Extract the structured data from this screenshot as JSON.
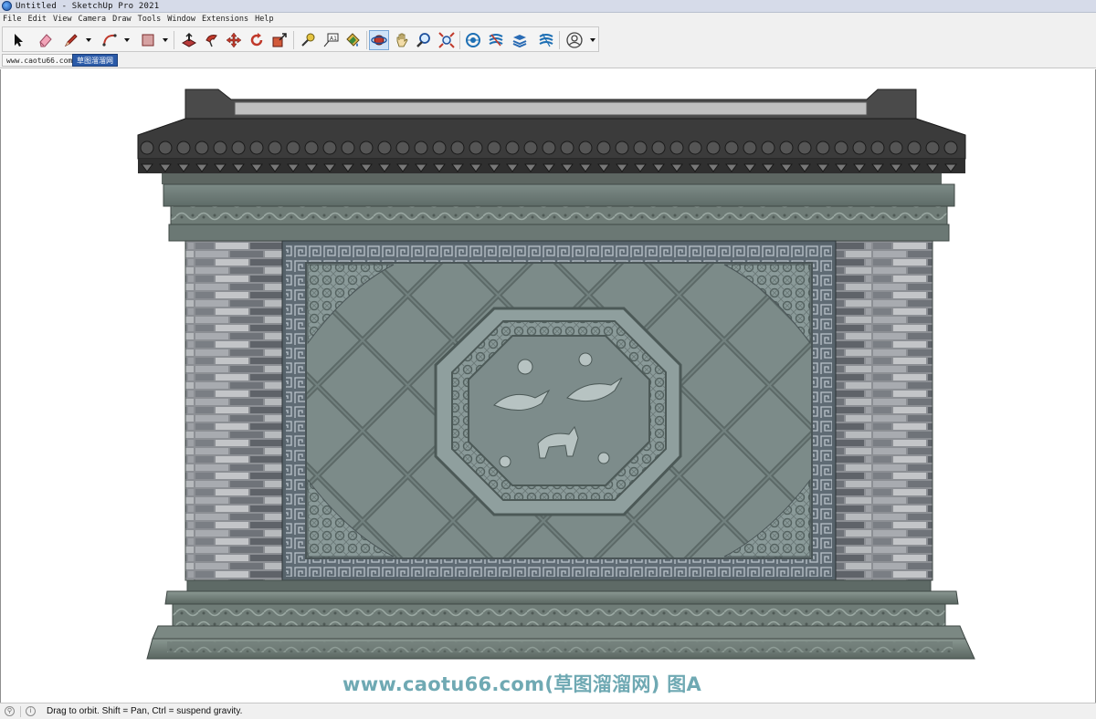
{
  "window": {
    "title": "Untitled - SketchUp Pro 2021"
  },
  "menu": [
    "File",
    "Edit",
    "View",
    "Camera",
    "Draw",
    "Tools",
    "Window",
    "Extensions",
    "Help"
  ],
  "toolbar": {
    "tools": [
      "select-tool",
      "eraser-tool",
      "line-tool",
      "arc-tool",
      "rectangle-tool",
      "push-pull-tool",
      "follow-me-tool",
      "move-tool",
      "rotate-tool",
      "scale-tool",
      "tape-measure-tool",
      "text-tool",
      "paint-bucket-tool",
      "orbit-tool",
      "pan-tool",
      "zoom-tool",
      "zoom-extents-tool",
      "warehouse-tool",
      "extension-warehouse-tool",
      "layout-tool",
      "extension-manager-tool",
      "account-tool"
    ],
    "active_tool": "orbit-tool"
  },
  "scenes": {
    "tab1": "www.caotu66.com",
    "tab2": "草图溜溜网"
  },
  "viewport": {
    "watermark": "www.caotu66.com(草图溜溜网) 图A"
  },
  "status": {
    "message": "Drag to orbit. Shift = Pan, Ctrl = suspend gravity."
  },
  "colors": {
    "accent": "#2a5aa8",
    "watermark": "#6fa9b3",
    "stone": "#6f7e7a",
    "roof": "#3d3d3d"
  }
}
